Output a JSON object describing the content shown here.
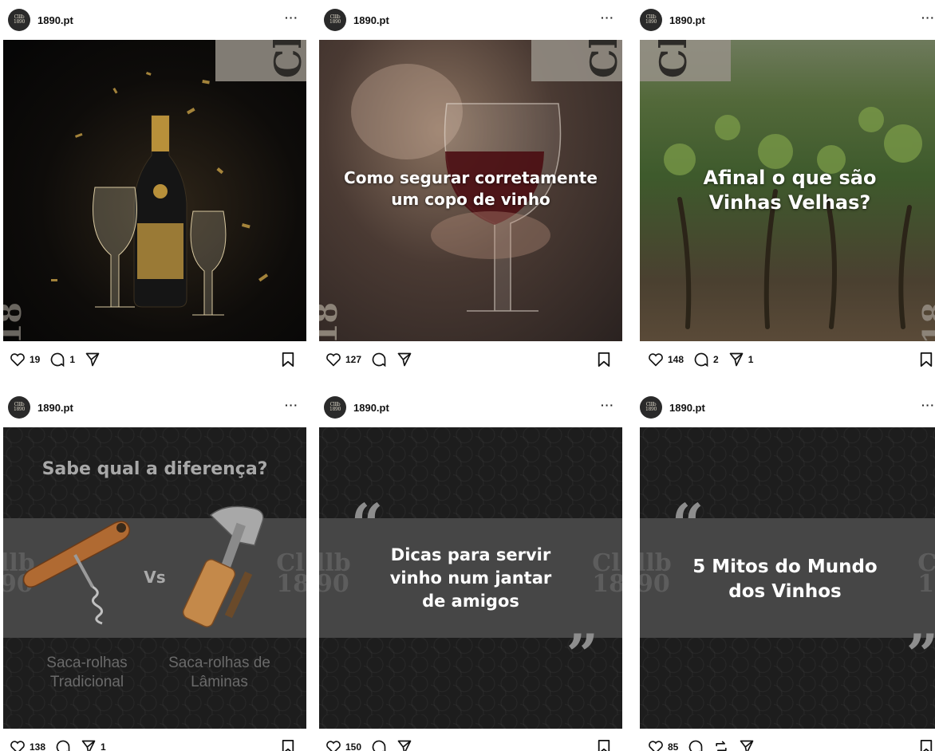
{
  "posts": [
    {
      "username": "1890.pt",
      "more": "···",
      "avatar_text": [
        "Clllb",
        "1890"
      ],
      "title": "",
      "likes": "19",
      "comments": "1",
      "shares": "",
      "logo": [
        "Cl",
        "18"
      ]
    },
    {
      "username": "1890.pt",
      "more": "···",
      "avatar_text": [
        "Clllb",
        "1890"
      ],
      "title": "Como segurar corretamente um copo de vinho",
      "likes": "127",
      "comments": "",
      "shares": "",
      "logo": [
        "Cl",
        "18"
      ]
    },
    {
      "username": "1890.pt",
      "more": "···",
      "avatar_text": [
        "Clllb",
        "1890"
      ],
      "title": "Afinal o que são Vinhas Velhas?",
      "likes": "148",
      "comments": "2",
      "shares": "1",
      "logo": [
        "Cl",
        "18"
      ]
    },
    {
      "username": "1890.pt",
      "more": "···",
      "avatar_text": [
        "Clllb",
        "1890"
      ],
      "title": "Sabe qual a diferença?",
      "vs": "Vs",
      "left_label": "Saca-rolhas Tradicional",
      "right_label": "Saca-rolhas de Lâminas",
      "likes": "138",
      "comments": "",
      "shares": "1"
    },
    {
      "username": "1890.pt",
      "more": "···",
      "avatar_text": [
        "Clllb",
        "1890"
      ],
      "title": "Dicas para servir vinho num jantar de amigos",
      "likes": "150",
      "comments": "",
      "shares": ""
    },
    {
      "username": "1890.pt",
      "more": "···",
      "avatar_text": [
        "Clllb",
        "1890"
      ],
      "title": "5 Mitos do Mundo dos Vinhos",
      "likes": "85",
      "comments": "",
      "shares": ""
    }
  ],
  "side_logo_left": [
    "llb",
    "90"
  ],
  "side_logo_right": [
    "Cl",
    "18"
  ],
  "quote_open": "“",
  "quote_close": "”",
  "icons": {
    "like": "heart-icon",
    "comment": "comment-icon",
    "share": "send-icon",
    "repost": "repost-icon",
    "save": "bookmark-icon"
  },
  "colors": {
    "accent_dark": "#1d1d1d",
    "band": "#464646",
    "logo_box": "#969187"
  }
}
